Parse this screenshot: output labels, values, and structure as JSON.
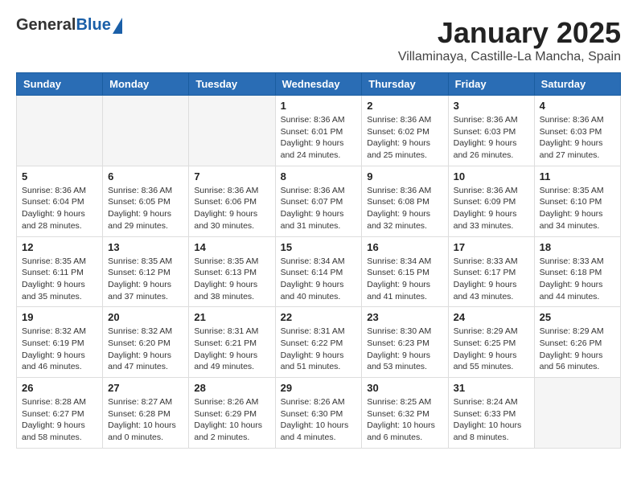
{
  "header": {
    "logo_general": "General",
    "logo_blue": "Blue",
    "month_title": "January 2025",
    "location": "Villaminaya, Castille-La Mancha, Spain"
  },
  "weekdays": [
    "Sunday",
    "Monday",
    "Tuesday",
    "Wednesday",
    "Thursday",
    "Friday",
    "Saturday"
  ],
  "weeks": [
    [
      {
        "day": "",
        "empty": true
      },
      {
        "day": "",
        "empty": true
      },
      {
        "day": "",
        "empty": true
      },
      {
        "day": "1",
        "sunrise": "8:36 AM",
        "sunset": "6:01 PM",
        "daylight": "9 hours and 24 minutes."
      },
      {
        "day": "2",
        "sunrise": "8:36 AM",
        "sunset": "6:02 PM",
        "daylight": "9 hours and 25 minutes."
      },
      {
        "day": "3",
        "sunrise": "8:36 AM",
        "sunset": "6:03 PM",
        "daylight": "9 hours and 26 minutes."
      },
      {
        "day": "4",
        "sunrise": "8:36 AM",
        "sunset": "6:03 PM",
        "daylight": "9 hours and 27 minutes."
      }
    ],
    [
      {
        "day": "5",
        "sunrise": "8:36 AM",
        "sunset": "6:04 PM",
        "daylight": "9 hours and 28 minutes."
      },
      {
        "day": "6",
        "sunrise": "8:36 AM",
        "sunset": "6:05 PM",
        "daylight": "9 hours and 29 minutes."
      },
      {
        "day": "7",
        "sunrise": "8:36 AM",
        "sunset": "6:06 PM",
        "daylight": "9 hours and 30 minutes."
      },
      {
        "day": "8",
        "sunrise": "8:36 AM",
        "sunset": "6:07 PM",
        "daylight": "9 hours and 31 minutes."
      },
      {
        "day": "9",
        "sunrise": "8:36 AM",
        "sunset": "6:08 PM",
        "daylight": "9 hours and 32 minutes."
      },
      {
        "day": "10",
        "sunrise": "8:36 AM",
        "sunset": "6:09 PM",
        "daylight": "9 hours and 33 minutes."
      },
      {
        "day": "11",
        "sunrise": "8:35 AM",
        "sunset": "6:10 PM",
        "daylight": "9 hours and 34 minutes."
      }
    ],
    [
      {
        "day": "12",
        "sunrise": "8:35 AM",
        "sunset": "6:11 PM",
        "daylight": "9 hours and 35 minutes."
      },
      {
        "day": "13",
        "sunrise": "8:35 AM",
        "sunset": "6:12 PM",
        "daylight": "9 hours and 37 minutes."
      },
      {
        "day": "14",
        "sunrise": "8:35 AM",
        "sunset": "6:13 PM",
        "daylight": "9 hours and 38 minutes."
      },
      {
        "day": "15",
        "sunrise": "8:34 AM",
        "sunset": "6:14 PM",
        "daylight": "9 hours and 40 minutes."
      },
      {
        "day": "16",
        "sunrise": "8:34 AM",
        "sunset": "6:15 PM",
        "daylight": "9 hours and 41 minutes."
      },
      {
        "day": "17",
        "sunrise": "8:33 AM",
        "sunset": "6:17 PM",
        "daylight": "9 hours and 43 minutes."
      },
      {
        "day": "18",
        "sunrise": "8:33 AM",
        "sunset": "6:18 PM",
        "daylight": "9 hours and 44 minutes."
      }
    ],
    [
      {
        "day": "19",
        "sunrise": "8:32 AM",
        "sunset": "6:19 PM",
        "daylight": "9 hours and 46 minutes."
      },
      {
        "day": "20",
        "sunrise": "8:32 AM",
        "sunset": "6:20 PM",
        "daylight": "9 hours and 47 minutes."
      },
      {
        "day": "21",
        "sunrise": "8:31 AM",
        "sunset": "6:21 PM",
        "daylight": "9 hours and 49 minutes."
      },
      {
        "day": "22",
        "sunrise": "8:31 AM",
        "sunset": "6:22 PM",
        "daylight": "9 hours and 51 minutes."
      },
      {
        "day": "23",
        "sunrise": "8:30 AM",
        "sunset": "6:23 PM",
        "daylight": "9 hours and 53 minutes."
      },
      {
        "day": "24",
        "sunrise": "8:29 AM",
        "sunset": "6:25 PM",
        "daylight": "9 hours and 55 minutes."
      },
      {
        "day": "25",
        "sunrise": "8:29 AM",
        "sunset": "6:26 PM",
        "daylight": "9 hours and 56 minutes."
      }
    ],
    [
      {
        "day": "26",
        "sunrise": "8:28 AM",
        "sunset": "6:27 PM",
        "daylight": "9 hours and 58 minutes."
      },
      {
        "day": "27",
        "sunrise": "8:27 AM",
        "sunset": "6:28 PM",
        "daylight": "10 hours and 0 minutes."
      },
      {
        "day": "28",
        "sunrise": "8:26 AM",
        "sunset": "6:29 PM",
        "daylight": "10 hours and 2 minutes."
      },
      {
        "day": "29",
        "sunrise": "8:26 AM",
        "sunset": "6:30 PM",
        "daylight": "10 hours and 4 minutes."
      },
      {
        "day": "30",
        "sunrise": "8:25 AM",
        "sunset": "6:32 PM",
        "daylight": "10 hours and 6 minutes."
      },
      {
        "day": "31",
        "sunrise": "8:24 AM",
        "sunset": "6:33 PM",
        "daylight": "10 hours and 8 minutes."
      },
      {
        "day": "",
        "empty": true
      }
    ]
  ]
}
